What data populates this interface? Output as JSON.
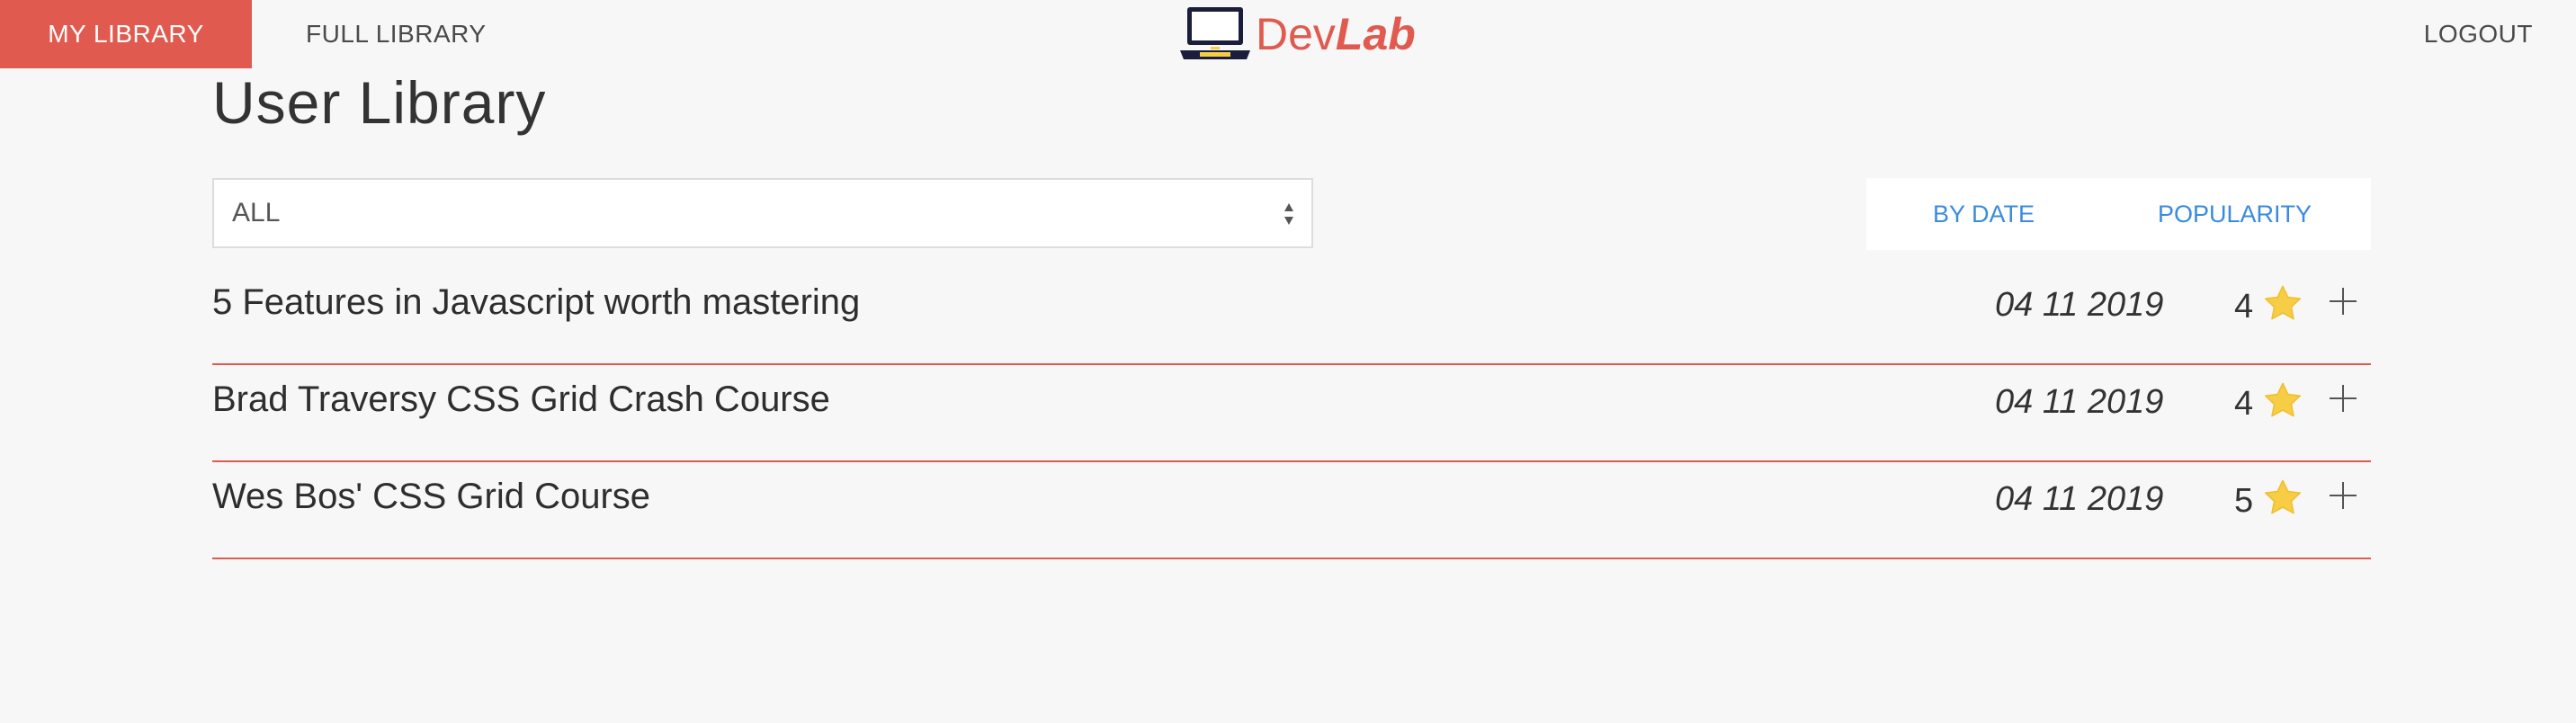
{
  "nav": {
    "my_library": "MY LIBRARY",
    "full_library": "FULL LIBRARY",
    "logout": "LOGOUT"
  },
  "brand": {
    "name_regular": "Dev",
    "name_bold": "Lab",
    "logo_icon": "laptop-icon"
  },
  "page": {
    "title": "User Library"
  },
  "filter": {
    "selected": "ALL"
  },
  "sort": {
    "by_date": "BY DATE",
    "popularity": "POPULARITY"
  },
  "items": [
    {
      "title": "5 Features in Javascript worth mastering",
      "date": "04 11 2019",
      "rating": "4"
    },
    {
      "title": "Brad Traversy CSS Grid Crash Course",
      "date": "04 11 2019",
      "rating": "4"
    },
    {
      "title": "Wes Bos' CSS Grid Course",
      "date": "04 11 2019",
      "rating": "5"
    }
  ],
  "colors": {
    "accent": "#e05a4f",
    "link": "#3a8be0",
    "star": "#f7cd46",
    "background": "#f7f7f7"
  },
  "icons": {
    "rating": "star-icon",
    "add": "plus-icon",
    "select": "select-arrows-icon"
  }
}
